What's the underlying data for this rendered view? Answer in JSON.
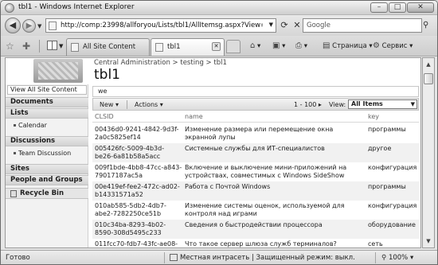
{
  "window": {
    "title": "tbl1 - Windows Internet Explorer",
    "minimize": "–",
    "maximize": "□",
    "close": "✕"
  },
  "address": {
    "url": "http://comp:23998/allforyou/Lists/tbl1/AllItemsg.aspx?View=",
    "search_placeholder": "Google"
  },
  "tabs": [
    {
      "label": "All Site Content"
    },
    {
      "label": "tbl1"
    }
  ],
  "commands": {
    "page": "Страница",
    "service": "Сервис"
  },
  "site": {
    "breadcrumb": "Central Administration > testing > tbl1",
    "title": "tbl1"
  },
  "leftnav": {
    "view_all": "View All Site Content",
    "documents": "Documents",
    "lists": "Lists",
    "calendar": "Calendar",
    "discussions": "Discussions",
    "team_discussion": "Team Discussion",
    "sites": "Sites",
    "people_groups": "People and Groups",
    "recycle_bin": "Recycle Bin"
  },
  "list": {
    "description": "we",
    "toolbar": {
      "new": "New",
      "actions": "Actions",
      "paging": "1 - 100",
      "view_label": "View:",
      "view_value": "All Items"
    },
    "columns": [
      "CLSID",
      "name",
      "key"
    ],
    "rows": [
      {
        "clsid": "00436d0-9241-4842-9d3f-2a0c5825ef14",
        "name": "Изменение размера или перемещение окна экранной лупы",
        "key": "программы"
      },
      {
        "clsid": "005426fc-5009-4b3d-be26-6a81b58a5acc",
        "name": "Системные службы для ИТ-специалистов",
        "key": "другое"
      },
      {
        "clsid": "009f1bde-4bb8-47cc-a843-79017187ac5a",
        "name": "Включение и выключение мини-приложений на устройствах, совместимых с Windows SideShow",
        "key": "конфигурация"
      },
      {
        "clsid": "00e419ef-fee2-472c-ad02-b14331571a52",
        "name": "Работа с Почтой Windows",
        "key": "программы"
      },
      {
        "clsid": "010ab585-5db2-4db7-abe2-7282250ce51b",
        "name": "Изменение системы оценок, используемой для контроля над играми",
        "key": "конфигурация"
      },
      {
        "clsid": "010c34ba-8293-4b02-8590-308d5495c233",
        "name": "Сведения о быстродействии процессора",
        "key": "оборудование"
      },
      {
        "clsid": "011fcc70-fdb7-43fc-ae08-",
        "name": "Что такое сервер шлюза служб терминалов?",
        "key": "сеть"
      }
    ]
  },
  "status": {
    "left": "Готово",
    "zone": "Местная интрасеть | Защищенный режим: выкл.",
    "zoom": "100%"
  }
}
